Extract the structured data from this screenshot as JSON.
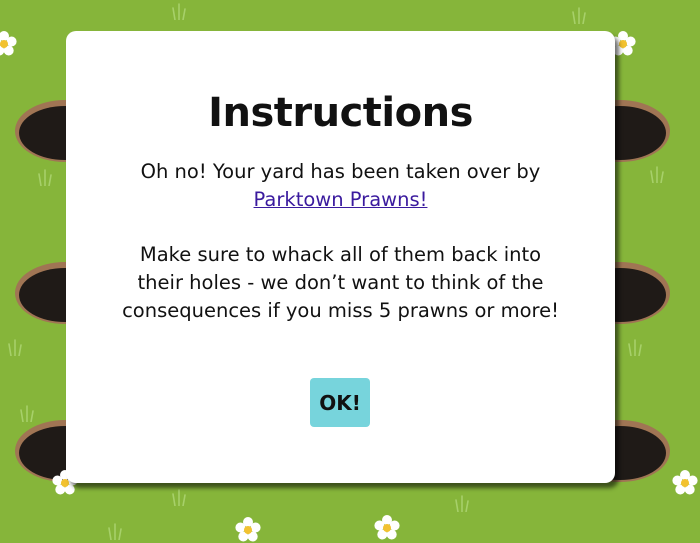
{
  "game": {
    "background_color": "#86b53a",
    "hole_color": "#1f1a17",
    "hole_rim_color": "#a07554"
  },
  "modal": {
    "title": "Instructions",
    "intro_text": "Oh no! Your yard has been taken over by ",
    "link_text": "Parktown Prawns!",
    "body_text": "Make sure to whack all of them back into their holes - we don’t want to think of the consequences if you miss 5 prawns or more!",
    "ok_label": "OK!",
    "link_color": "#3a1a9e",
    "button_color": "#77d4dc"
  }
}
